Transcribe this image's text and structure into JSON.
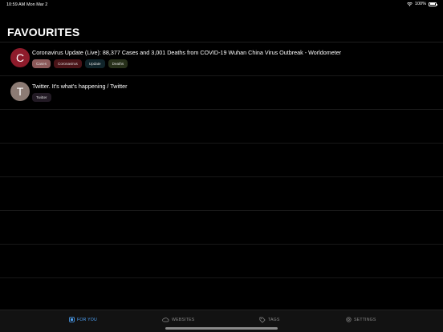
{
  "status": {
    "time": "10:59 AM",
    "date": "Mon Mar 2",
    "battery": "100%"
  },
  "page": {
    "title": "FAVOURITES"
  },
  "favourites": [
    {
      "letter": "C",
      "avatar_color": "#8e1b2b",
      "title": "Coronavirus Update (Live): 88,377 Cases and 3,001 Deaths from COVID-19 Wuhan China Virus Outbreak - Worldometer",
      "tags": [
        {
          "label": "Cases",
          "color": "#8c5a5a"
        },
        {
          "label": "Coronavirus",
          "color": "#4a1418"
        },
        {
          "label": "Update",
          "color": "#10242a"
        },
        {
          "label": "Deaths",
          "color": "#27301a"
        }
      ]
    },
    {
      "letter": "T",
      "avatar_color": "#8c7b74",
      "title": "Twitter. It's what's happening / Twitter",
      "tags": [
        {
          "label": "Twitter",
          "color": "#221a24"
        }
      ]
    }
  ],
  "tabs": [
    {
      "label": "FOR YOU",
      "icon": "for-you-icon",
      "active": true
    },
    {
      "label": "WEBSITES",
      "icon": "cloud-icon",
      "active": false
    },
    {
      "label": "TAGS",
      "icon": "tag-icon",
      "active": false
    },
    {
      "label": "SETTINGS",
      "icon": "gear-icon",
      "active": false
    }
  ],
  "colors": {
    "accent": "#4fa3f7",
    "background": "#000000",
    "tab_bar": "#121212"
  }
}
